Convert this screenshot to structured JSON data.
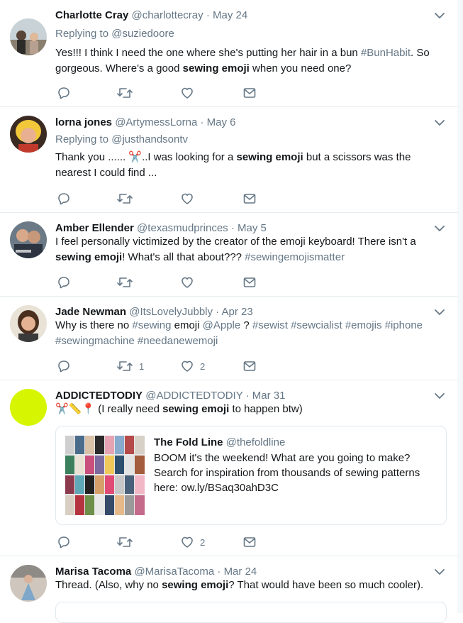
{
  "tweets": [
    {
      "name": "Charlotte Cray",
      "handle": "@charlottecray",
      "date": "May 24",
      "reply_prefix": "Replying to",
      "reply_to": "@suziedoore",
      "text": {
        "t1": "Yes!!! I think I need the one where she's putting her hair in a bun ",
        "tag1": "#BunHabit",
        "t2": ". So gorgeous. Where's a good ",
        "bold": "sewing emoji",
        "t3": " when you need one?"
      }
    },
    {
      "name": "lorna jones",
      "handle": "@ArtymessLorna",
      "date": "May 6",
      "reply_prefix": "Replying to",
      "reply_to": "@justhandsontv",
      "text": {
        "t1": "Thank you ...... ",
        "emoji": "✂️",
        "t2": "..I was looking for a ",
        "bold": "sewing emoji",
        "t3": " but a scissors was the nearest I could find ..."
      }
    },
    {
      "name": "Amber Ellender",
      "handle": "@texasmudprinces",
      "date": "May 5",
      "text": {
        "t1": "I feel personally victimized by the creator of the emoji keyboard! There isn't a ",
        "bold": "sewing emoji",
        "t2": "! What's all that about??? ",
        "tag1": "#sewingemojismatter"
      }
    },
    {
      "name": "Jade Newman",
      "handle": "@ItsLovelyJubbly",
      "date": "Apr 23",
      "retweets": "1",
      "likes": "2",
      "text": {
        "t1": "Why is there no ",
        "tag1": "#sewing",
        "t2": " emoji ",
        "tag2": "@Apple",
        "t3": " ? ",
        "tag3": "#sewist #sewcialist #emojis #iphone #sewingmachine #needanewemoji"
      }
    },
    {
      "name": "ADDICTEDTODIY",
      "handle": "@ADDICTEDTODIY",
      "date": "Mar 31",
      "likes": "2",
      "text": {
        "emoji": "✂️📏📍",
        "t1": " (I really need ",
        "bold": "sewing emoji",
        "t2": " to happen btw)"
      },
      "card": {
        "name": "The Fold Line",
        "handle": "@thefoldline",
        "text": "BOOM it's the weekend! What are you going to make? Search for inspiration from thousands of sewing patterns here: ow.ly/BSaq30ahD3C"
      }
    },
    {
      "name": "Marisa Tacoma",
      "handle": "@MarisaTacoma",
      "date": "Mar 24",
      "text": {
        "t1": "Thread. (Also, why no ",
        "bold": "sewing emoji",
        "t2": "? That would have been so much cooler)."
      }
    }
  ],
  "separator": "·",
  "colors": {
    "accent": "#1da1f2",
    "muted": "#657786",
    "text": "#14171a",
    "border": "#e6ecf0",
    "yellow_avatar": "#d6f500"
  },
  "icons": [
    "reply-icon",
    "retweet-icon",
    "like-icon",
    "dm-icon",
    "chevron-down-icon"
  ]
}
